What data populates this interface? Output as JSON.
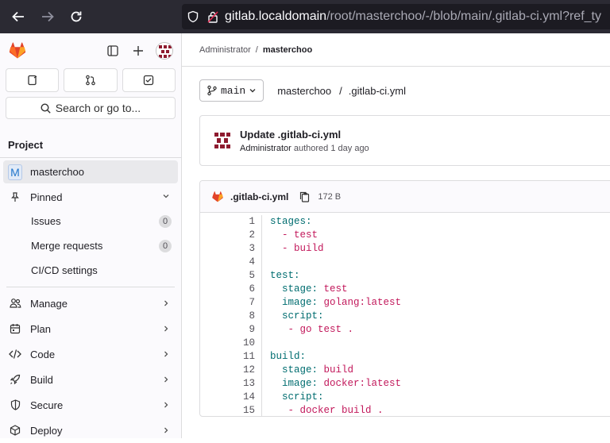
{
  "browser": {
    "url_host": "gitlab.localdomain",
    "url_path": "/root/masterchoo/-/blob/main/.gitlab-ci.yml?ref_ty"
  },
  "sidebar": {
    "search_label": "Search or go to...",
    "section_title": "Project",
    "project": {
      "initial": "M",
      "name": "masterchoo"
    },
    "pinned_label": "Pinned",
    "pinned_items": [
      {
        "label": "Issues",
        "count": "0"
      },
      {
        "label": "Merge requests",
        "count": "0"
      },
      {
        "label": "CI/CD settings"
      }
    ],
    "groups": [
      {
        "label": "Manage",
        "icon": "users-icon"
      },
      {
        "label": "Plan",
        "icon": "calendar-icon"
      },
      {
        "label": "Code",
        "icon": "code-icon"
      },
      {
        "label": "Build",
        "icon": "rocket-icon"
      },
      {
        "label": "Secure",
        "icon": "shield-icon"
      },
      {
        "label": "Deploy",
        "icon": "deploy-icon"
      }
    ]
  },
  "breadcrumb": {
    "parent": "Administrator",
    "separator": "/",
    "current": "masterchoo"
  },
  "file_path": {
    "branch": "main",
    "project": "masterchoo",
    "separator": "/",
    "file": ".gitlab-ci.yml"
  },
  "commit": {
    "message": "Update .gitlab-ci.yml",
    "author": "Administrator",
    "action": "authored",
    "time": "1 day ago"
  },
  "file": {
    "name": ".gitlab-ci.yml",
    "size": "172 B"
  },
  "code_lines": [
    {
      "n": "1",
      "parts": [
        {
          "t": "stages:",
          "c": "k"
        }
      ]
    },
    {
      "n": "2",
      "parts": [
        {
          "t": "  - ",
          "c": "s"
        },
        {
          "t": "test",
          "c": "s"
        }
      ]
    },
    {
      "n": "3",
      "parts": [
        {
          "t": "  - ",
          "c": "s"
        },
        {
          "t": "build",
          "c": "s"
        }
      ]
    },
    {
      "n": "4",
      "parts": []
    },
    {
      "n": "5",
      "parts": [
        {
          "t": "test:",
          "c": "k"
        }
      ]
    },
    {
      "n": "6",
      "parts": [
        {
          "t": "  stage: ",
          "c": "k"
        },
        {
          "t": "test",
          "c": "s"
        }
      ]
    },
    {
      "n": "7",
      "parts": [
        {
          "t": "  image: ",
          "c": "k"
        },
        {
          "t": "golang:latest",
          "c": "s"
        }
      ]
    },
    {
      "n": "8",
      "parts": [
        {
          "t": "  script:",
          "c": "k"
        }
      ]
    },
    {
      "n": "9",
      "parts": [
        {
          "t": "   - go test .",
          "c": "s"
        }
      ]
    },
    {
      "n": "10",
      "parts": []
    },
    {
      "n": "11",
      "parts": [
        {
          "t": "build:",
          "c": "k"
        }
      ]
    },
    {
      "n": "12",
      "parts": [
        {
          "t": "  stage: ",
          "c": "k"
        },
        {
          "t": "build",
          "c": "s"
        }
      ]
    },
    {
      "n": "13",
      "parts": [
        {
          "t": "  image: ",
          "c": "k"
        },
        {
          "t": "docker:latest",
          "c": "s"
        }
      ]
    },
    {
      "n": "14",
      "parts": [
        {
          "t": "  script:",
          "c": "k"
        }
      ]
    },
    {
      "n": "15",
      "parts": [
        {
          "t": "   - docker build .",
          "c": "s"
        }
      ]
    }
  ],
  "colors": {
    "key": "#006d70",
    "string": "#c2185b",
    "brand": "#e24329"
  }
}
